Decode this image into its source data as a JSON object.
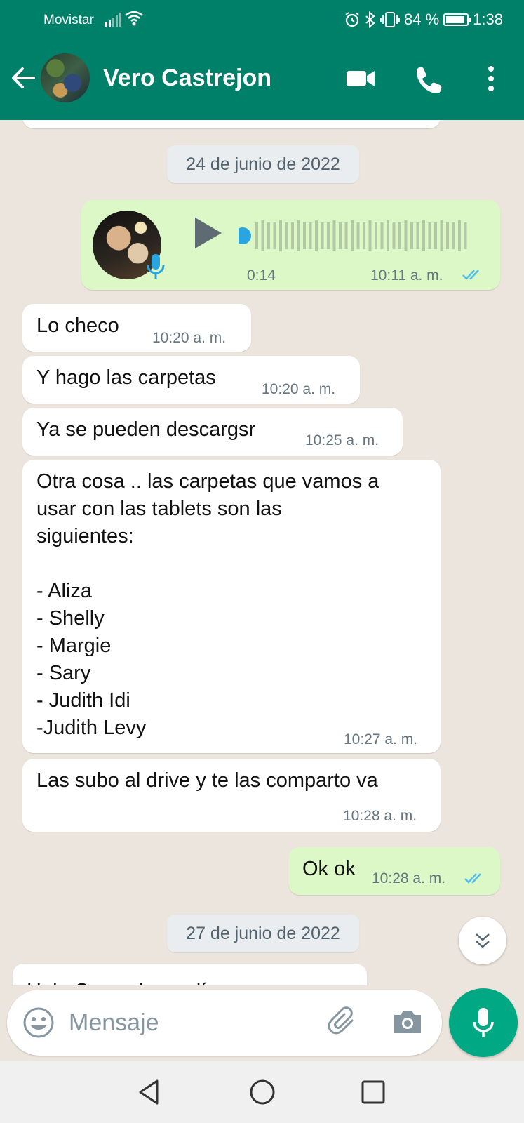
{
  "status": {
    "carrier": "Movistar",
    "battery": "84 %",
    "time": "1:38"
  },
  "header": {
    "contact_name": "Vero Castrejon"
  },
  "chat": {
    "dates": [
      "24 de junio de 2022",
      "27 de junio de 2022"
    ],
    "voice": {
      "duration": "0:14",
      "time": "10:11 a. m.",
      "direction": "outgoing"
    },
    "messages": [
      {
        "text": "Lo checo",
        "time": "10:20 a. m.",
        "direction": "incoming"
      },
      {
        "text": "Y hago las carpetas",
        "time": "10:20 a. m.",
        "direction": "incoming"
      },
      {
        "text": "Ya se pueden descargsr",
        "time": "10:25 a. m.",
        "direction": "incoming"
      },
      {
        "text": "Otra cosa .. las carpetas que vamos a\nusar con las tablets son las\nsiguientes:\n\n- Aliza\n- Shelly\n- Margie\n- Sary\n- Judith Idi\n-Judith Levy",
        "time": "10:27 a. m.",
        "direction": "incoming"
      },
      {
        "text": "Las subo al drive y te las comparto va",
        "time": "10:28 a. m.",
        "direction": "incoming"
      },
      {
        "text": "Ok ok",
        "time": "10:28 a. m.",
        "direction": "outgoing"
      },
      {
        "text": "Hola Cesar, buen día",
        "time": "",
        "direction": "incoming",
        "partial": true
      }
    ]
  },
  "composer": {
    "placeholder": "Mensaje"
  },
  "colors": {
    "header": "#008069",
    "outgoing_bubble": "#dcf8c6",
    "incoming_bubble": "#ffffff",
    "chat_background": "#ece5dd",
    "tick_read": "#53bdeb",
    "mic_button": "#00a884"
  }
}
